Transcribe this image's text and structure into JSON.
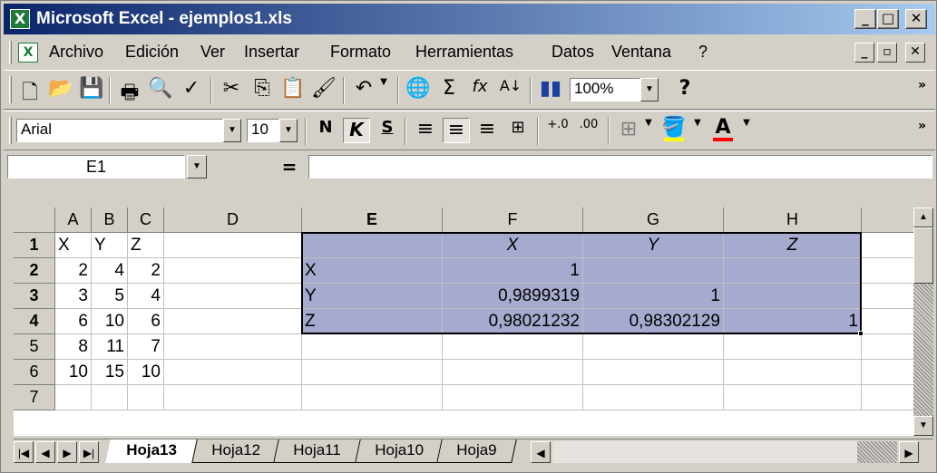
{
  "window": {
    "title": "Microsoft Excel - ejemplos1.xls"
  },
  "menu": [
    "Archivo",
    "Edición",
    "Ver",
    "Insertar",
    "Formato",
    "Herramientas",
    "Datos",
    "Ventana",
    "?"
  ],
  "toolbar_standard": {
    "zoom": "100%"
  },
  "toolbar_format": {
    "font": "Arial",
    "size": "10",
    "bold": "N",
    "italic": "K",
    "underline": "S",
    "inc_dec": ".0 .00"
  },
  "formula_bar": {
    "name_box": "E1",
    "equals": "=",
    "formula": ""
  },
  "columns": [
    "A",
    "B",
    "C",
    "D",
    "E",
    "F",
    "G",
    "H"
  ],
  "rows": [
    "1",
    "2",
    "3",
    "4",
    "5",
    "6",
    "7"
  ],
  "cells": {
    "A1": "X",
    "B1": "Y",
    "C1": "Z",
    "A2": "2",
    "B2": "4",
    "C2": "2",
    "A3": "3",
    "B3": "5",
    "C3": "4",
    "A4": "6",
    "B4": "10",
    "C4": "6",
    "A5": "8",
    "B5": "11",
    "C5": "7",
    "A6": "10",
    "B6": "15",
    "C6": "10",
    "E1": "",
    "F1": "X",
    "G1": "Y",
    "H1": "Z",
    "E2": "X",
    "F2": "1",
    "G2": "",
    "H2": "",
    "E3": "Y",
    "F3": "0,9899319",
    "G3": "1",
    "H3": "",
    "E4": "Z",
    "F4": "0,98021232",
    "G4": "0,98302129",
    "H4": "1"
  },
  "sheet_tabs": [
    "Hoja13",
    "Hoja12",
    "Hoja11",
    "Hoja10",
    "Hoja9"
  ],
  "active_sheet": "Hoja13",
  "colors": {
    "selection_fill": "#a5aace",
    "title_gradient_start": "#0a246a",
    "title_gradient_end": "#a6caf0"
  }
}
